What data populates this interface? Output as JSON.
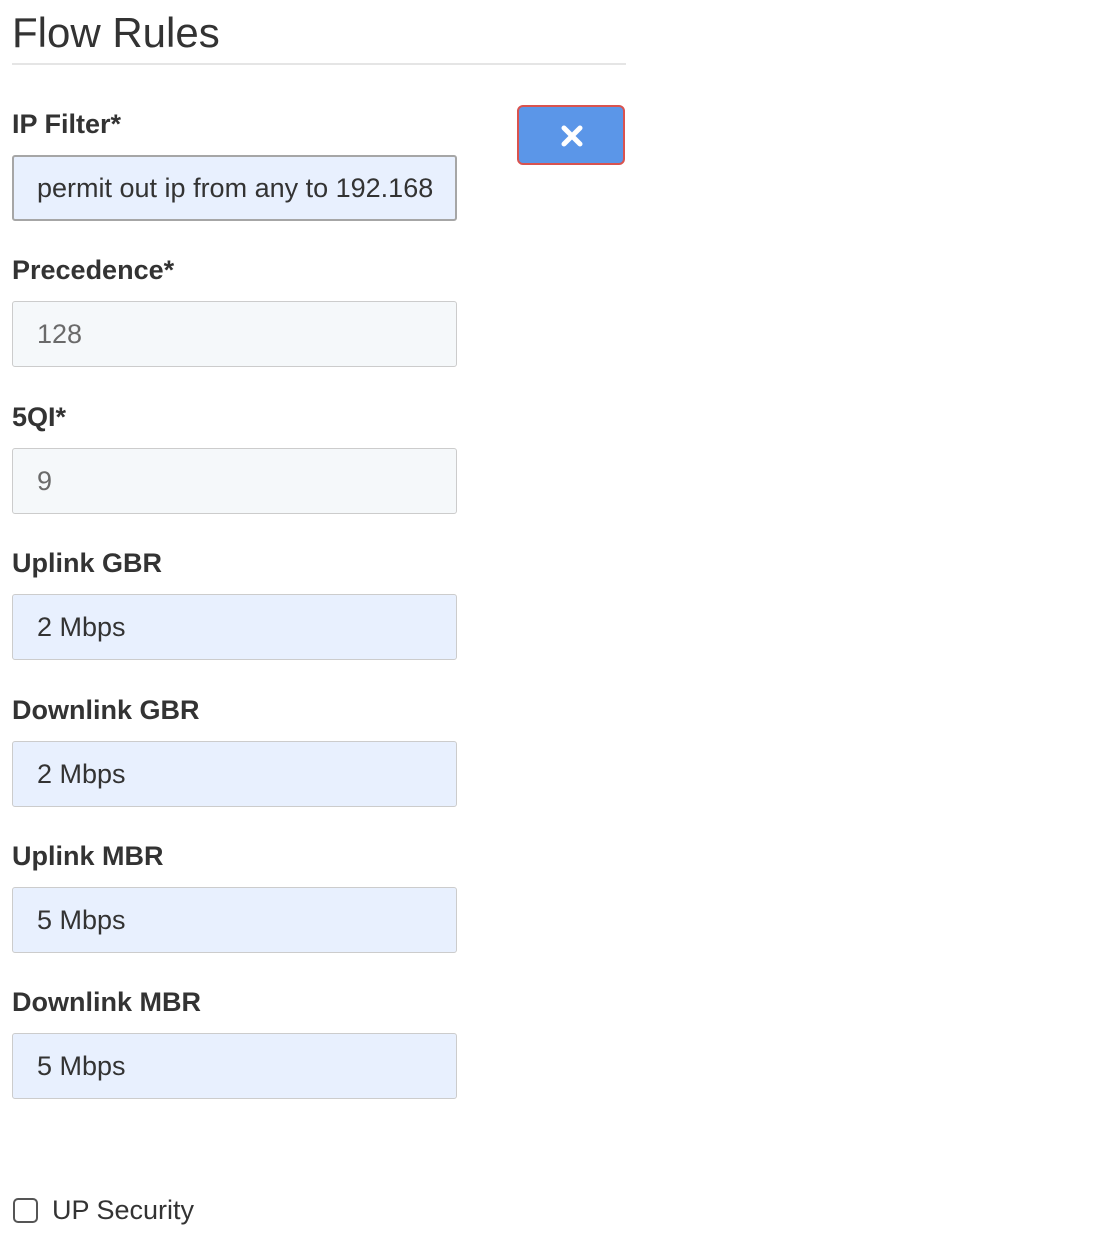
{
  "section": {
    "title": "Flow Rules"
  },
  "buttons": {
    "remove_icon": "close-icon"
  },
  "fields": {
    "ip_filter": {
      "label": "IP Filter*",
      "value": "permit out ip from any  to 192.168"
    },
    "precedence": {
      "label": "Precedence*",
      "placeholder": "128"
    },
    "five_qi": {
      "label": "5QI*",
      "placeholder": "9"
    },
    "uplink_gbr": {
      "label": "Uplink GBR",
      "value": "2 Mbps"
    },
    "downlink_gbr": {
      "label": "Downlink GBR",
      "value": "2 Mbps"
    },
    "uplink_mbr": {
      "label": "Uplink MBR",
      "value": "5 Mbps"
    },
    "downlink_mbr": {
      "label": "Downlink MBR",
      "value": "5 Mbps"
    }
  },
  "up_security": {
    "label": "UP Security",
    "checked": false
  },
  "colors": {
    "button_fill": "#5b96e8",
    "button_border": "#d9534f",
    "autofill_background": "#e8f0fe"
  }
}
